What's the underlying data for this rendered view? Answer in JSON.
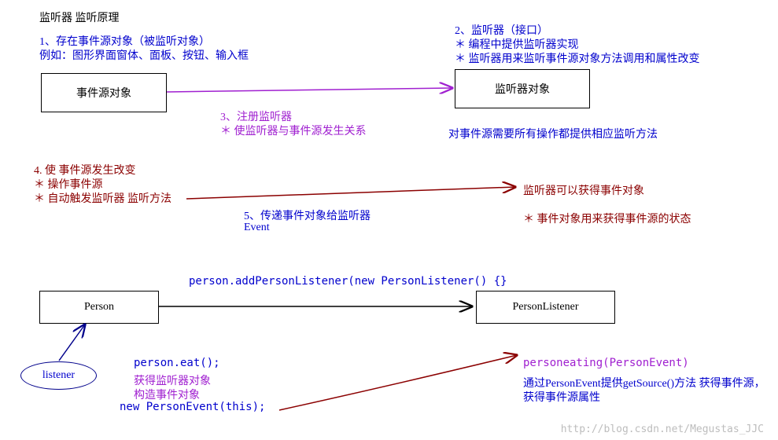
{
  "title": "监听器 监听原理",
  "step1": {
    "line1": "1、存在事件源对象（被监听对象）",
    "line2": "例如：图形界面窗体、面板、按钮、输入框"
  },
  "box_source": "事件源对象",
  "step2": {
    "line1": "2、监听器（接口）",
    "line2": "＊ 编程中提供监听器实现",
    "line3": "＊ 监听器用来监听事件源对象方法调用和属性改变"
  },
  "box_listener": "监听器对象",
  "step3": {
    "line1": "3、注册监听器",
    "line2": "＊ 使监听器与事件源发生关系"
  },
  "note_blue_right": "对事件源需要所有操作都提供相应监听方法",
  "step4": {
    "line1": "4. 使 事件源发生改变",
    "line2": "＊ 操作事件源",
    "line3": "＊ 自动触发监听器 监听方法"
  },
  "step5": {
    "line1": "5、传递事件对象给监听器",
    "line2": "Event"
  },
  "right_dr": {
    "line1": "监听器可以获得事件对象",
    "line2": "＊ 事件对象用来获得事件源的状态"
  },
  "code_top": "person.addPersonListener(new PersonListener() {}",
  "box_person": "Person",
  "box_pl": "PersonListener",
  "ellipse_label": "listener",
  "bottom_left": {
    "l1": "person.eat();",
    "l2": "获得监听器对象",
    "l3": "构造事件对象",
    "l4": "new PersonEvent(this);"
  },
  "bottom_right": {
    "l1": "personeating(PersonEvent)",
    "l2": "通过PersonEvent提供getSource()方法 获得事件源，获得事件源属性"
  },
  "watermark": "http://blog.csdn.net/Megustas_JJC"
}
